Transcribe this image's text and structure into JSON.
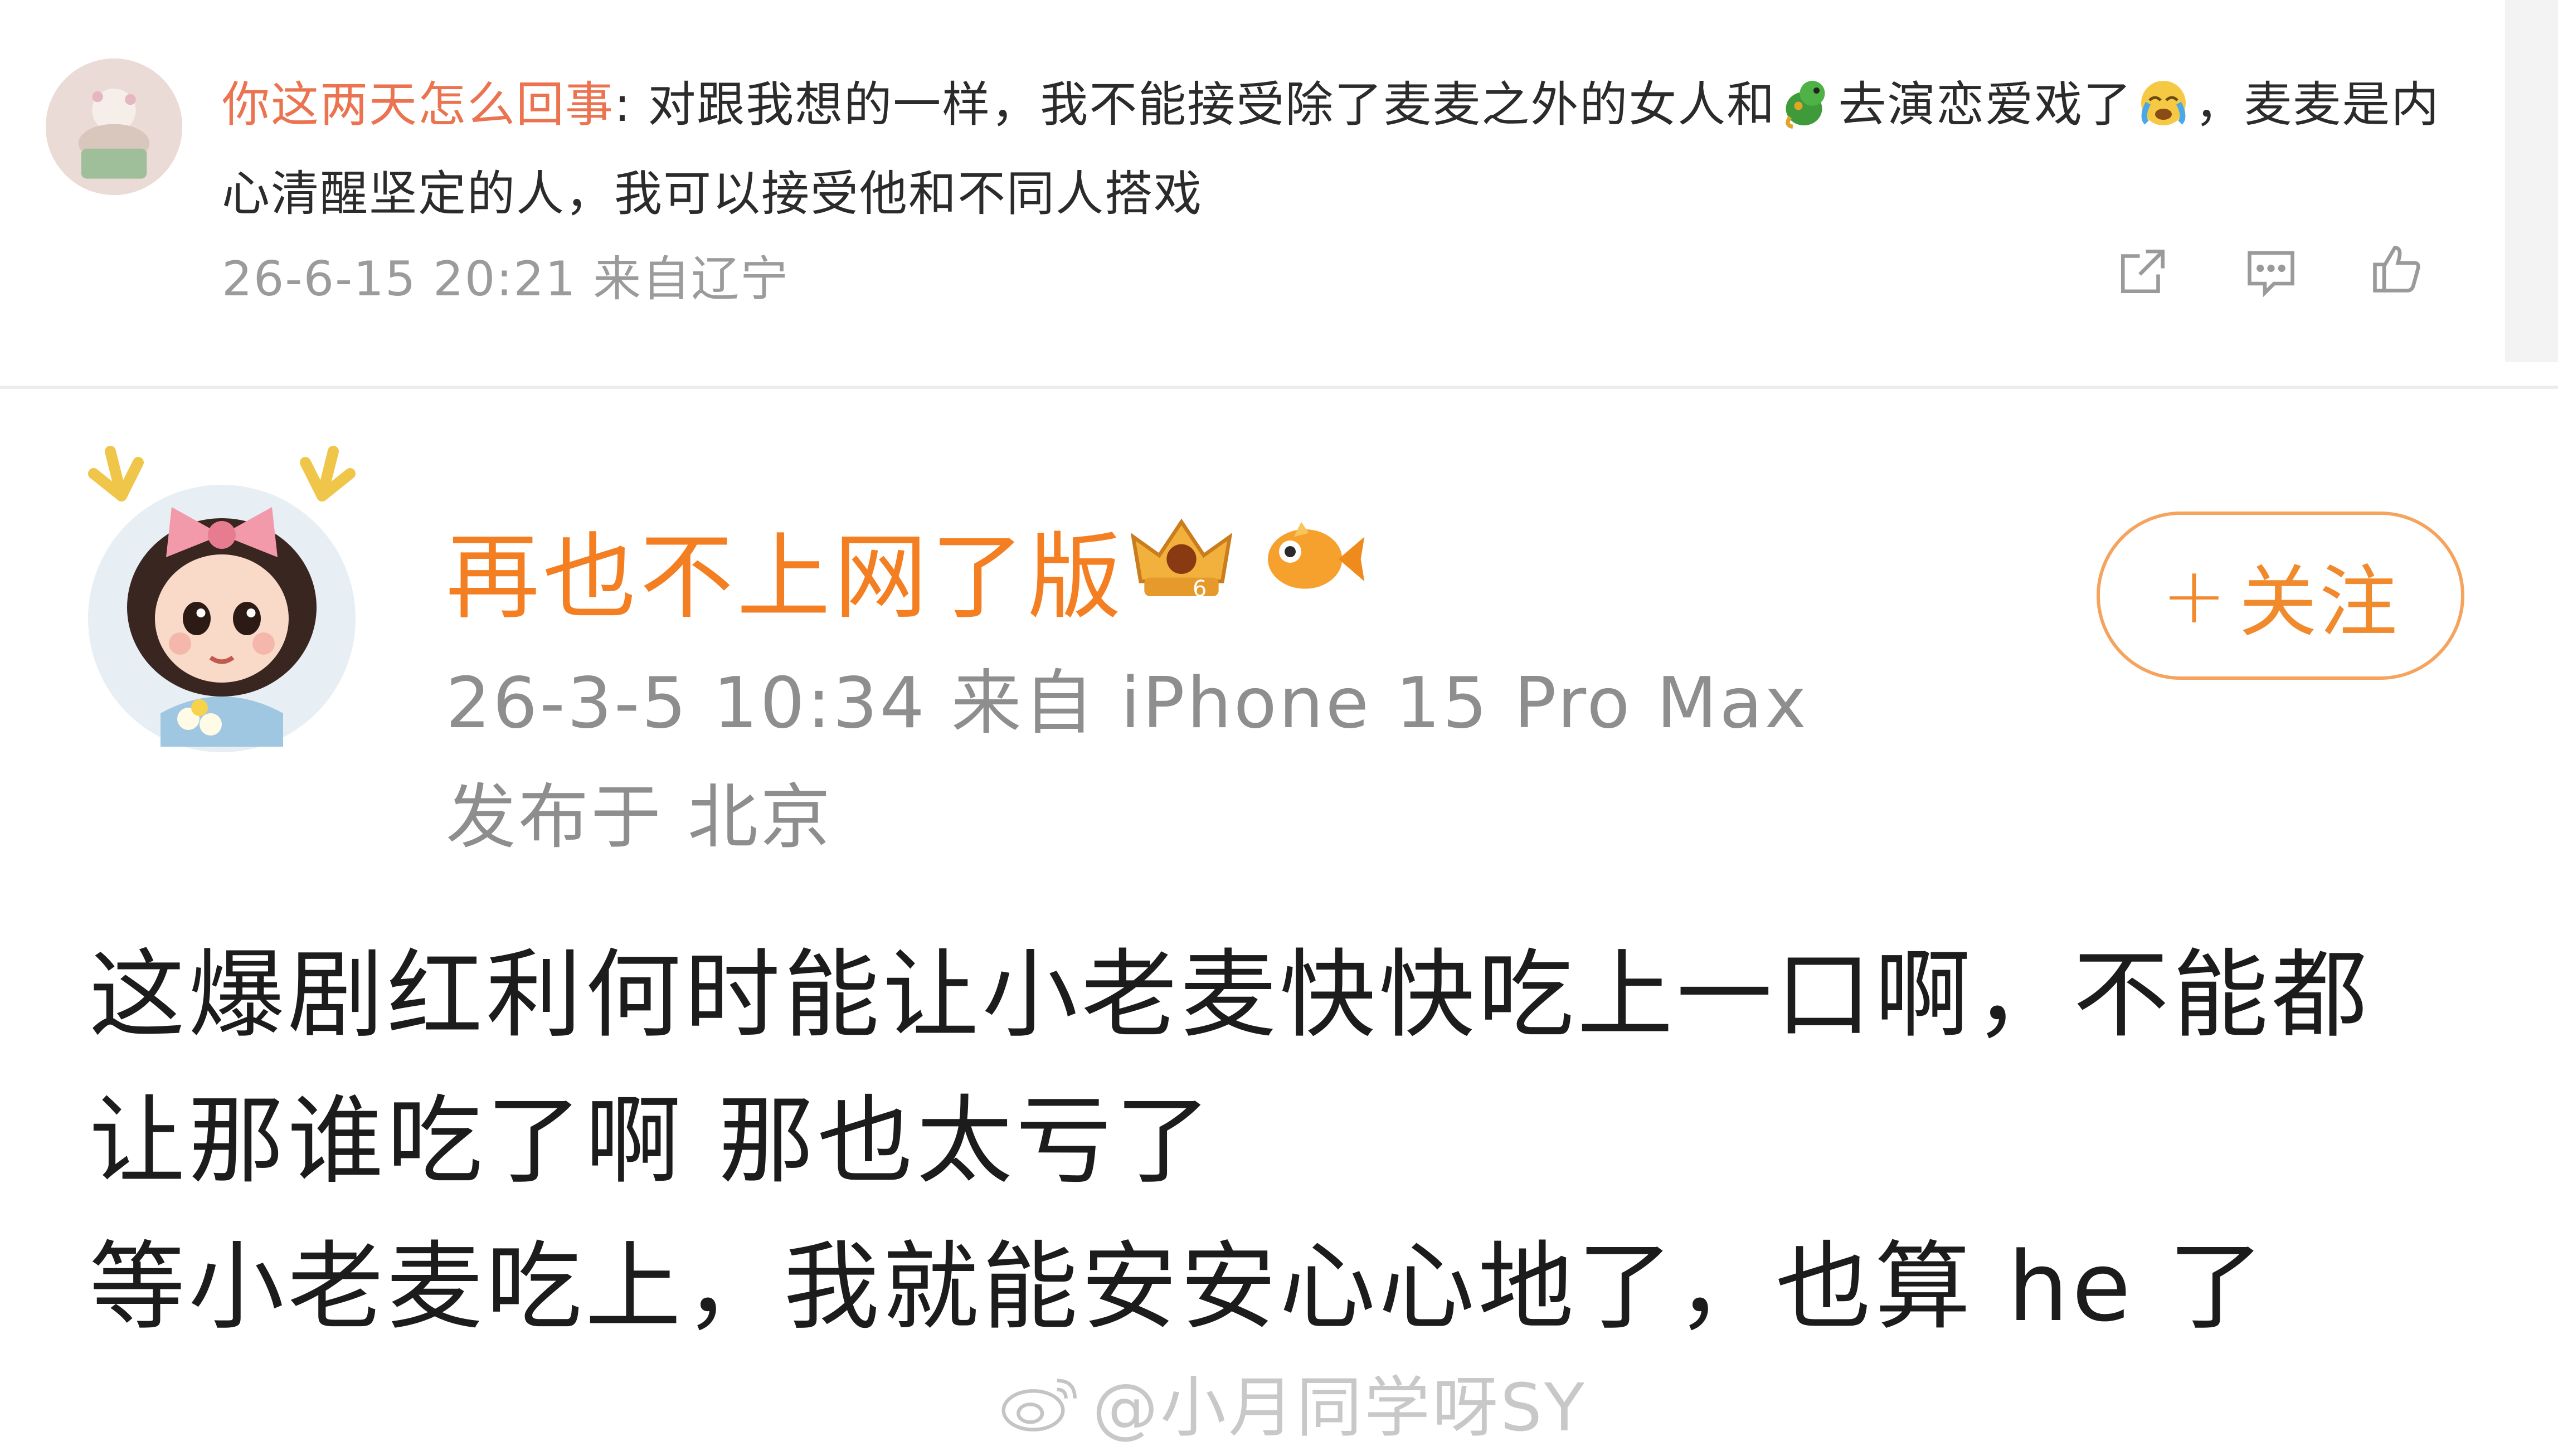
{
  "comment": {
    "username": "你这两天怎么回事",
    "separator": ": ",
    "text_part1": "对跟我想的一样，我不能接受除了麦麦之外的女人和",
    "text_part2": "去演恋爱戏了",
    "text_part3": "，麦麦是内心清醒坚定的人，我可以接受他和不同人搭戏",
    "meta": "26-6-15 20:21 来自辽宁",
    "emoji_1": "green-character-emoji",
    "emoji_2": "crying-face-emoji",
    "actions": [
      "share-icon",
      "comment-icon",
      "like-icon"
    ]
  },
  "post": {
    "username": "再也不上网了版",
    "badges": [
      "vip-crown-badge",
      "fish-badge"
    ],
    "follow_label": "关注",
    "follow_plus": "+",
    "meta": "26-3-5 10:34  来自 iPhone 15 Pro Max",
    "location": "发布于 北京",
    "body_lines": [
      "这爆剧红利何时能让小老麦快快吃上一口啊，不能都",
      "让那谁吃了啊 那也太亏了",
      "等小老麦吃上，我就能安安心心地了，也算 he 了"
    ]
  },
  "watermark": {
    "text": "@小月同学呀SY",
    "logo": "weibo-logo"
  },
  "colors": {
    "username_orange": "#f47f22",
    "comment_user": "#eb7350",
    "follow_border": "#f5a35d",
    "meta_gray": "#8e8e8e"
  }
}
